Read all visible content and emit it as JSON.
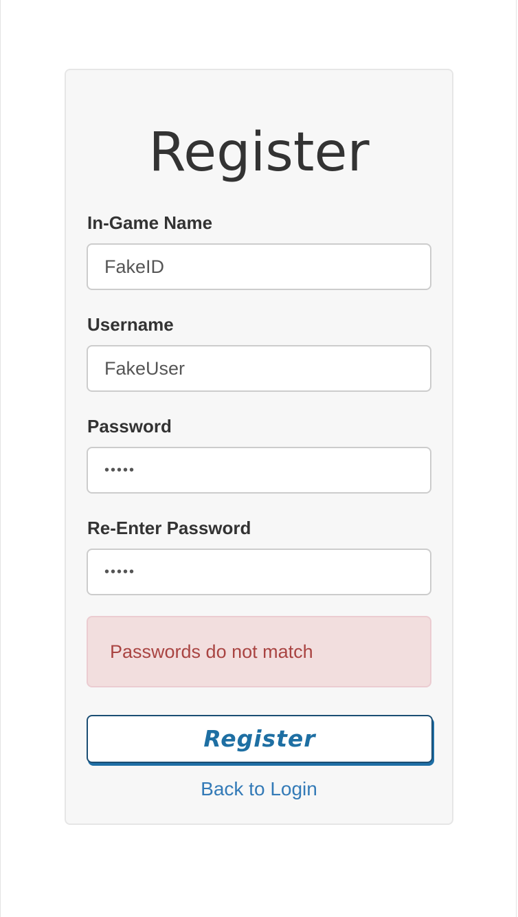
{
  "form": {
    "title": "Register",
    "fields": [
      {
        "label": "In-Game Name",
        "value": "FakeID",
        "type": "text"
      },
      {
        "label": "Username",
        "value": "FakeUser",
        "type": "text"
      },
      {
        "label": "Password",
        "value": "•••••",
        "type": "password"
      },
      {
        "label": "Re-Enter Password",
        "value": "•••••",
        "type": "password"
      }
    ],
    "error_message": "Passwords do not match",
    "submit_label": "Register",
    "back_link": "Back to Login"
  },
  "colors": {
    "card_background": "#f7f7f7",
    "error_background": "#f2dede",
    "error_text": "#a94442",
    "button_text": "#1e6fa3",
    "link": "#337ab7"
  }
}
